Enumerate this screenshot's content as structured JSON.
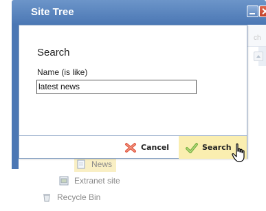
{
  "window": {
    "title": "Site Tree",
    "background_hint": "ch",
    "minimize_icon": "minimize-icon",
    "close_icon": "close-icon"
  },
  "dialog": {
    "heading": "Search",
    "field_label": "Name (is like)",
    "field_value": "latest news",
    "buttons": {
      "cancel_label": "Cancel",
      "cancel_icon": "cancel-x-icon",
      "search_label": "Search",
      "search_icon": "checkmark-icon"
    }
  },
  "tree": {
    "items": [
      {
        "label": "News",
        "icon": "page-icon",
        "highlighted": true
      },
      {
        "label": "Extranet site",
        "icon": "site-icon",
        "highlighted": false
      },
      {
        "label": "Recycle Bin",
        "icon": "trash-icon",
        "highlighted": false
      }
    ]
  },
  "colors": {
    "titlebar": "#4b77b4",
    "highlight": "#faeeb0",
    "cancel_icon": "#e05a44",
    "search_icon": "#7cb342"
  }
}
